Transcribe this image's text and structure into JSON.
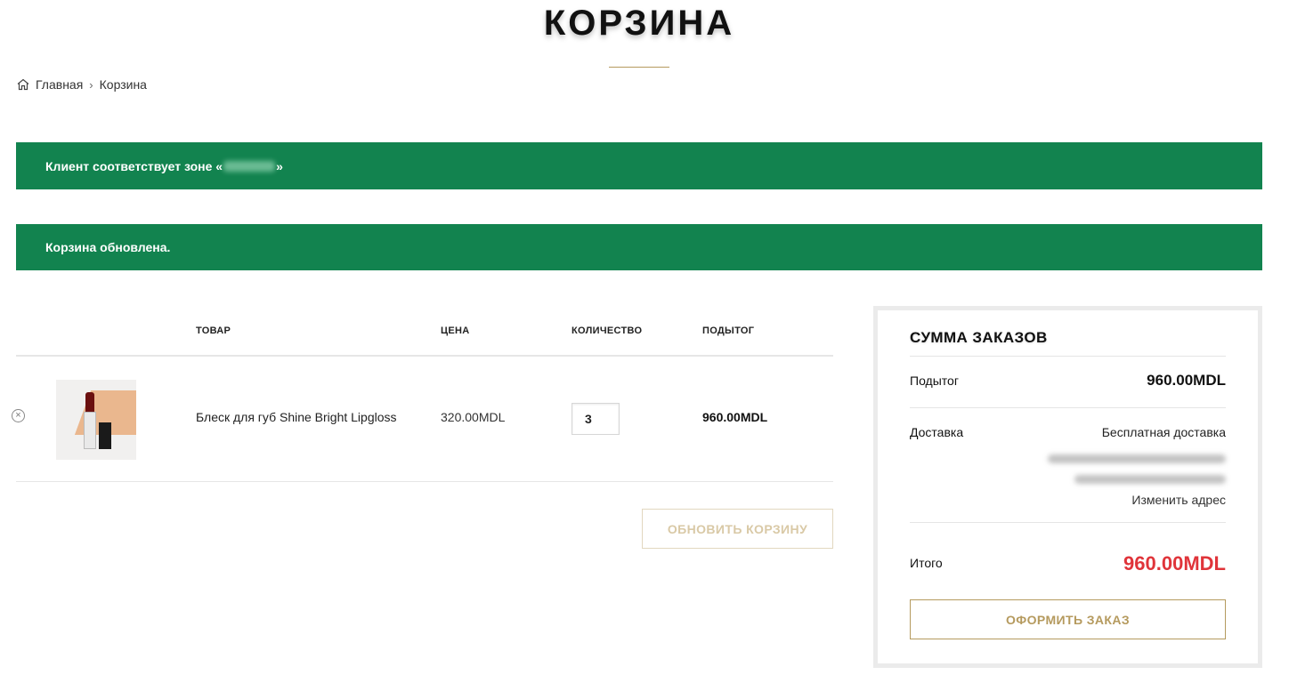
{
  "page": {
    "title": "КОРЗИНА"
  },
  "breadcrumb": {
    "home": "Главная",
    "separator": "›",
    "current": "Корзина"
  },
  "notices": {
    "zone_prefix": "Клиент соответствует зоне «",
    "zone_suffix": "»",
    "cart_updated": "Корзина обновлена."
  },
  "cart": {
    "headers": {
      "product": "ТОВАР",
      "price": "ЦЕНА",
      "quantity": "КОЛИЧЕСТВО",
      "subtotal": "ПОДЫТОГ"
    },
    "items": [
      {
        "name": "Блеск для губ Shine Bright Lipgloss",
        "price": "320.00MDL",
        "quantity": "3",
        "subtotal": "960.00MDL"
      }
    ],
    "update_button": "ОБНОВИТЬ КОРЗИНУ"
  },
  "totals": {
    "title": "СУММА ЗАКАЗОВ",
    "subtotal_label": "Подытог",
    "subtotal_value": "960.00MDL",
    "shipping_label": "Доставка",
    "shipping_value": "Бесплатная доставка",
    "change_address": "Изменить адрес",
    "total_label": "Итого",
    "total_value": "960.00MDL",
    "checkout_button": "ОФОРМИТЬ ЗАКАЗ"
  },
  "colors": {
    "notice_bg": "#12834f",
    "accent": "#b59a5e",
    "total_red": "#e0343a"
  },
  "icons": {
    "home": "home-icon",
    "remove": "remove-circle-icon"
  }
}
